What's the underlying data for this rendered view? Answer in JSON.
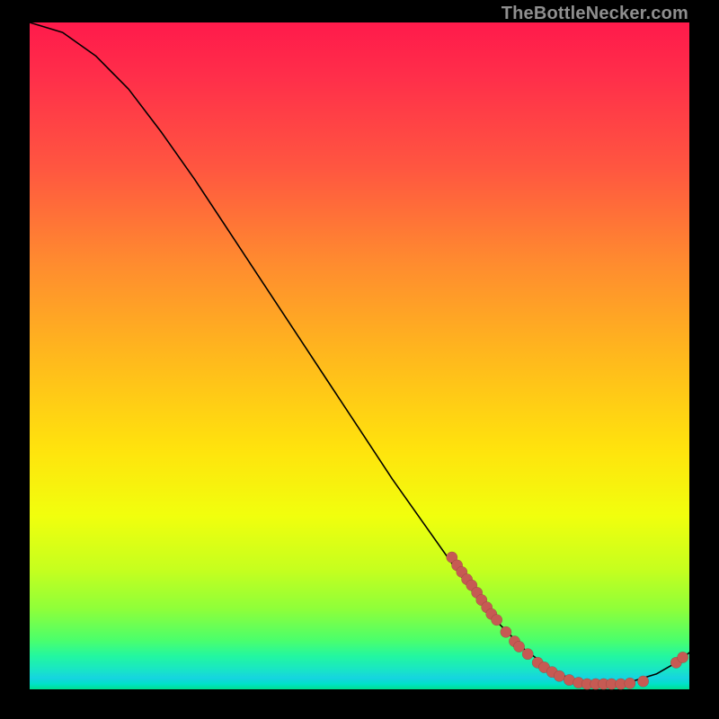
{
  "attribution": "TheBottleNecker.com",
  "colors": {
    "page_bg": "#000000",
    "point_fill": "#c65a53",
    "curve_stroke": "#000000"
  },
  "chart_data": {
    "type": "line",
    "title": "",
    "xlabel": "",
    "ylabel": "",
    "xlim": [
      0,
      100
    ],
    "ylim": [
      0,
      100
    ],
    "curve": [
      {
        "x": 0,
        "y": 100.0
      },
      {
        "x": 5,
        "y": 98.5
      },
      {
        "x": 10,
        "y": 95.0
      },
      {
        "x": 15,
        "y": 90.0
      },
      {
        "x": 20,
        "y": 83.5
      },
      {
        "x": 25,
        "y": 76.5
      },
      {
        "x": 30,
        "y": 69.0
      },
      {
        "x": 35,
        "y": 61.5
      },
      {
        "x": 40,
        "y": 54.0
      },
      {
        "x": 45,
        "y": 46.5
      },
      {
        "x": 50,
        "y": 39.0
      },
      {
        "x": 55,
        "y": 31.5
      },
      {
        "x": 60,
        "y": 24.5
      },
      {
        "x": 65,
        "y": 17.5
      },
      {
        "x": 70,
        "y": 11.0
      },
      {
        "x": 75,
        "y": 6.0
      },
      {
        "x": 80,
        "y": 2.3
      },
      {
        "x": 85,
        "y": 0.8
      },
      {
        "x": 90,
        "y": 0.8
      },
      {
        "x": 95,
        "y": 2.3
      },
      {
        "x": 98,
        "y": 4.0
      },
      {
        "x": 100,
        "y": 5.5
      }
    ],
    "points": [
      {
        "x": 64.0,
        "y": 19.8
      },
      {
        "x": 64.8,
        "y": 18.6
      },
      {
        "x": 65.5,
        "y": 17.6
      },
      {
        "x": 66.3,
        "y": 16.5
      },
      {
        "x": 67.0,
        "y": 15.6
      },
      {
        "x": 67.8,
        "y": 14.5
      },
      {
        "x": 68.5,
        "y": 13.4
      },
      {
        "x": 69.3,
        "y": 12.3
      },
      {
        "x": 70.0,
        "y": 11.3
      },
      {
        "x": 70.8,
        "y": 10.4
      },
      {
        "x": 72.2,
        "y": 8.6
      },
      {
        "x": 73.5,
        "y": 7.2
      },
      {
        "x": 74.2,
        "y": 6.4
      },
      {
        "x": 75.5,
        "y": 5.3
      },
      {
        "x": 77.0,
        "y": 4.0
      },
      {
        "x": 78.0,
        "y": 3.3
      },
      {
        "x": 79.2,
        "y": 2.6
      },
      {
        "x": 80.3,
        "y": 2.0
      },
      {
        "x": 81.8,
        "y": 1.4
      },
      {
        "x": 83.2,
        "y": 1.0
      },
      {
        "x": 84.5,
        "y": 0.8
      },
      {
        "x": 85.8,
        "y": 0.8
      },
      {
        "x": 87.0,
        "y": 0.8
      },
      {
        "x": 88.2,
        "y": 0.8
      },
      {
        "x": 89.6,
        "y": 0.8
      },
      {
        "x": 91.0,
        "y": 0.9
      },
      {
        "x": 93.0,
        "y": 1.2
      },
      {
        "x": 98.0,
        "y": 4.0
      },
      {
        "x": 99.0,
        "y": 4.8
      }
    ]
  }
}
